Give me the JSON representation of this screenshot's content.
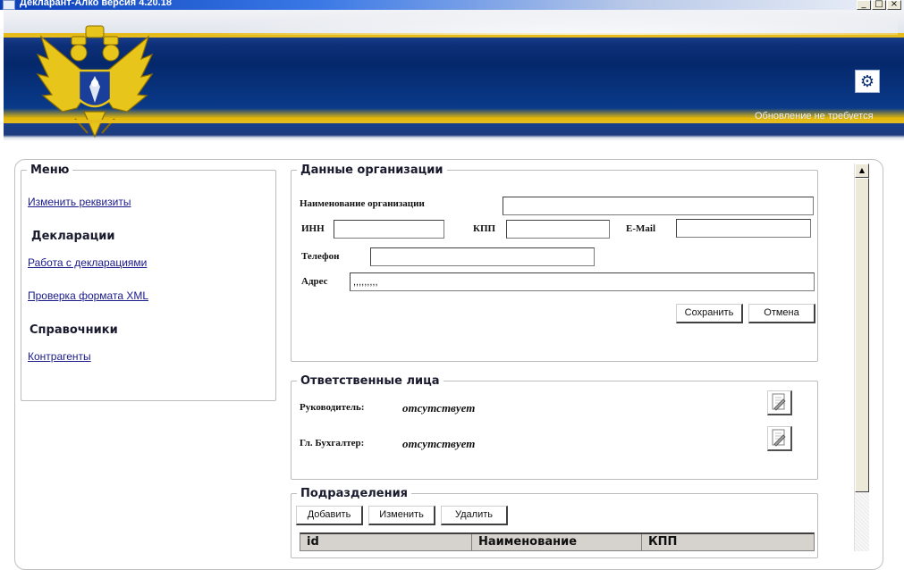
{
  "window": {
    "title": "Декларант-Алко версия 4.20.18",
    "buttons": {
      "minimize": "_",
      "maximize": "□",
      "close": "×"
    }
  },
  "banner": {
    "update_status": "Обновление не требуется",
    "settings_icon": "gear-icon",
    "emblem_icon": "double-headed-eagle-emblem",
    "colors": {
      "navy": "#0d2f78",
      "gold": "#e5bc1b"
    }
  },
  "menu": {
    "legend": "Меню",
    "edit_requisites": "Изменить реквизиты",
    "declarations_heading": "Декларации",
    "work_declarations": "Работа с декларациями",
    "check_xml": "Проверка формата XML",
    "references_heading": "Справочники",
    "counterparties": "Контрагенты"
  },
  "org": {
    "legend": "Данные организации",
    "name_label": "Наименование организации",
    "name_value": "",
    "inn_label": "ИНН",
    "inn_value": "",
    "kpp_label": "КПП",
    "kpp_value": "",
    "email_label": "E-Mail",
    "email_value": "",
    "phone_label": "Телефон",
    "phone_value": "",
    "address_label": "Адрес",
    "address_value": ",,,,,,,,,",
    "save_label": "Сохранить",
    "cancel_label": "Отмена"
  },
  "responsible": {
    "legend": "Ответственные лица",
    "director_label": "Руководитель:",
    "director_value": "отсутствует",
    "accountant_label": "Гл. Бухгалтер:",
    "accountant_value": "отсутствует",
    "edit_icon": "edit-document-icon"
  },
  "divisions": {
    "legend": "Подразделения",
    "add_label": "Добавить",
    "edit_label": "Изменить",
    "delete_label": "Удалить",
    "columns": [
      "id",
      "Наименование",
      "КПП"
    ]
  }
}
